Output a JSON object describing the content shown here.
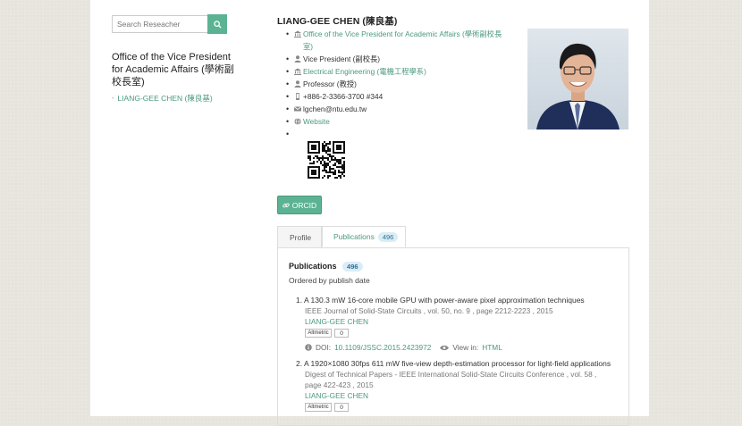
{
  "search": {
    "placeholder": "Search Reseacher"
  },
  "sidebar": {
    "title": "Office of the Vice President for Academic Affairs (學術副校長室)",
    "link": "LIANG-GEE CHEN (陳良基)"
  },
  "profile": {
    "name": "LIANG-GEE CHEN (陳良基)",
    "office": "Office of the Vice President for Academic Affairs (學術副校長室)",
    "position": "Vice President (副校長)",
    "department": "Electrical Engineering (電機工程學系)",
    "rank": "Professor (教授)",
    "phone": "+886-2-3366-3700 #344",
    "email": "lgchen@ntu.edu.tw",
    "website": "Website",
    "orcid_label": "ORCID"
  },
  "tabs": {
    "profile": "Profile",
    "publications": "Publications",
    "count": "496"
  },
  "publications": {
    "heading": "Publications",
    "count": "496",
    "order_note": "Ordered by publish date",
    "items": [
      {
        "title": "1. A 130.3 mW 16-core mobile GPU with power-aware pixel approximation techniques",
        "source": "IEEE Journal of Solid-State Circuits , vol. 50, no. 9 , page 2212-2223 , 2015",
        "author": "LIANG-GEE CHEN",
        "altmetric": "Altmetric",
        "altmetric_count": "0",
        "doi_label": "DOI:",
        "doi": "10.1109/JSSC.2015.2423972",
        "view_label": "View in:",
        "view_link": "HTML"
      },
      {
        "title": "2. A 1920×1080 30fps 611 mW five-view depth-estimation processor for light-field applications",
        "source": "Digest of Technical Papers - IEEE International Solid-State Circuits Conference , vol. 58 , page 422-423 , 2015",
        "author": "LIANG-GEE CHEN",
        "altmetric": "Altmetric",
        "altmetric_count": "0"
      }
    ]
  },
  "colors": {
    "accent": "#5cb394",
    "link": "#4a9a7d",
    "background": "#e9e6df"
  }
}
